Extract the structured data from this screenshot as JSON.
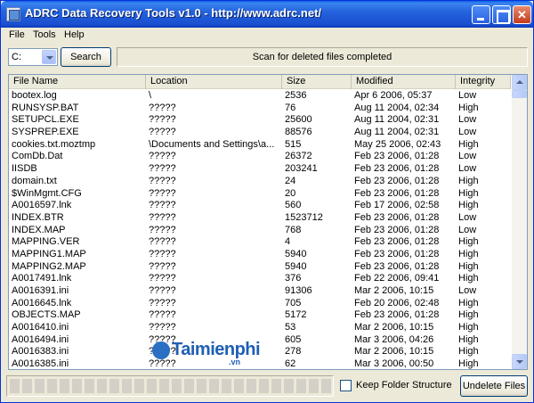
{
  "window": {
    "title": "ADRC Data Recovery Tools v1.0 - http://www.adrc.net/"
  },
  "menu": [
    "File",
    "Tools",
    "Help"
  ],
  "toolbar": {
    "drive": "C:",
    "search_label": "Search",
    "status": "Scan for deleted files completed"
  },
  "table": {
    "columns": [
      "File Name",
      "Location",
      "Size",
      "Modified",
      "Integrity"
    ],
    "rows": [
      [
        "bootex.log",
        "\\",
        "2536",
        "Apr 6 2006, 05:37",
        "Low"
      ],
      [
        "RUNSYSP.BAT",
        "?????",
        "76",
        "Aug 11 2004, 02:34",
        "High"
      ],
      [
        "SETUPCL.EXE",
        "?????",
        "25600",
        "Aug 11 2004, 02:31",
        "Low"
      ],
      [
        "SYSPREP.EXE",
        "?????",
        "88576",
        "Aug 11 2004, 02:31",
        "Low"
      ],
      [
        "cookies.txt.moztmp",
        "\\Documents and Settings\\a...",
        "515",
        "May 25 2006, 02:43",
        "High"
      ],
      [
        "ComDb.Dat",
        "?????",
        "26372",
        "Feb 23 2006, 01:28",
        "Low"
      ],
      [
        "IISDB",
        "?????",
        "203241",
        "Feb 23 2006, 01:28",
        "Low"
      ],
      [
        "domain.txt",
        "?????",
        "24",
        "Feb 23 2006, 01:28",
        "High"
      ],
      [
        "$WinMgmt.CFG",
        "?????",
        "20",
        "Feb 23 2006, 01:28",
        "High"
      ],
      [
        "A0016597.lnk",
        "?????",
        "560",
        "Feb 17 2006, 02:58",
        "High"
      ],
      [
        "INDEX.BTR",
        "?????",
        "1523712",
        "Feb 23 2006, 01:28",
        "Low"
      ],
      [
        "INDEX.MAP",
        "?????",
        "768",
        "Feb 23 2006, 01:28",
        "Low"
      ],
      [
        "MAPPING.VER",
        "?????",
        "4",
        "Feb 23 2006, 01:28",
        "High"
      ],
      [
        "MAPPING1.MAP",
        "?????",
        "5940",
        "Feb 23 2006, 01:28",
        "High"
      ],
      [
        "MAPPING2.MAP",
        "?????",
        "5940",
        "Feb 23 2006, 01:28",
        "High"
      ],
      [
        "A0017491.lnk",
        "?????",
        "376",
        "Feb 22 2006, 09:41",
        "High"
      ],
      [
        "A0016391.ini",
        "?????",
        "91306",
        "Mar 2 2006, 10:15",
        "Low"
      ],
      [
        "A0016645.lnk",
        "?????",
        "705",
        "Feb 20 2006, 02:48",
        "High"
      ],
      [
        "OBJECTS.MAP",
        "?????",
        "5172",
        "Feb 23 2006, 01:28",
        "High"
      ],
      [
        "A0016410.ini",
        "?????",
        "53",
        "Mar 2 2006, 10:15",
        "High"
      ],
      [
        "A0016494.ini",
        "?????",
        "605",
        "Mar 3 2006, 04:26",
        "High"
      ],
      [
        "A0016383.ini",
        "?????",
        "278",
        "Mar 2 2006, 10:15",
        "High"
      ],
      [
        "A0016385.ini",
        "?????",
        "62",
        "Mar 3 2006, 00:50",
        "High"
      ]
    ]
  },
  "bottom": {
    "keep_folder_label": "Keep Folder Structure",
    "keep_folder_checked": false,
    "undelete_label": "Undelete Files"
  },
  "watermark": {
    "brand": "Taimienphi",
    "suffix": ".vn"
  }
}
